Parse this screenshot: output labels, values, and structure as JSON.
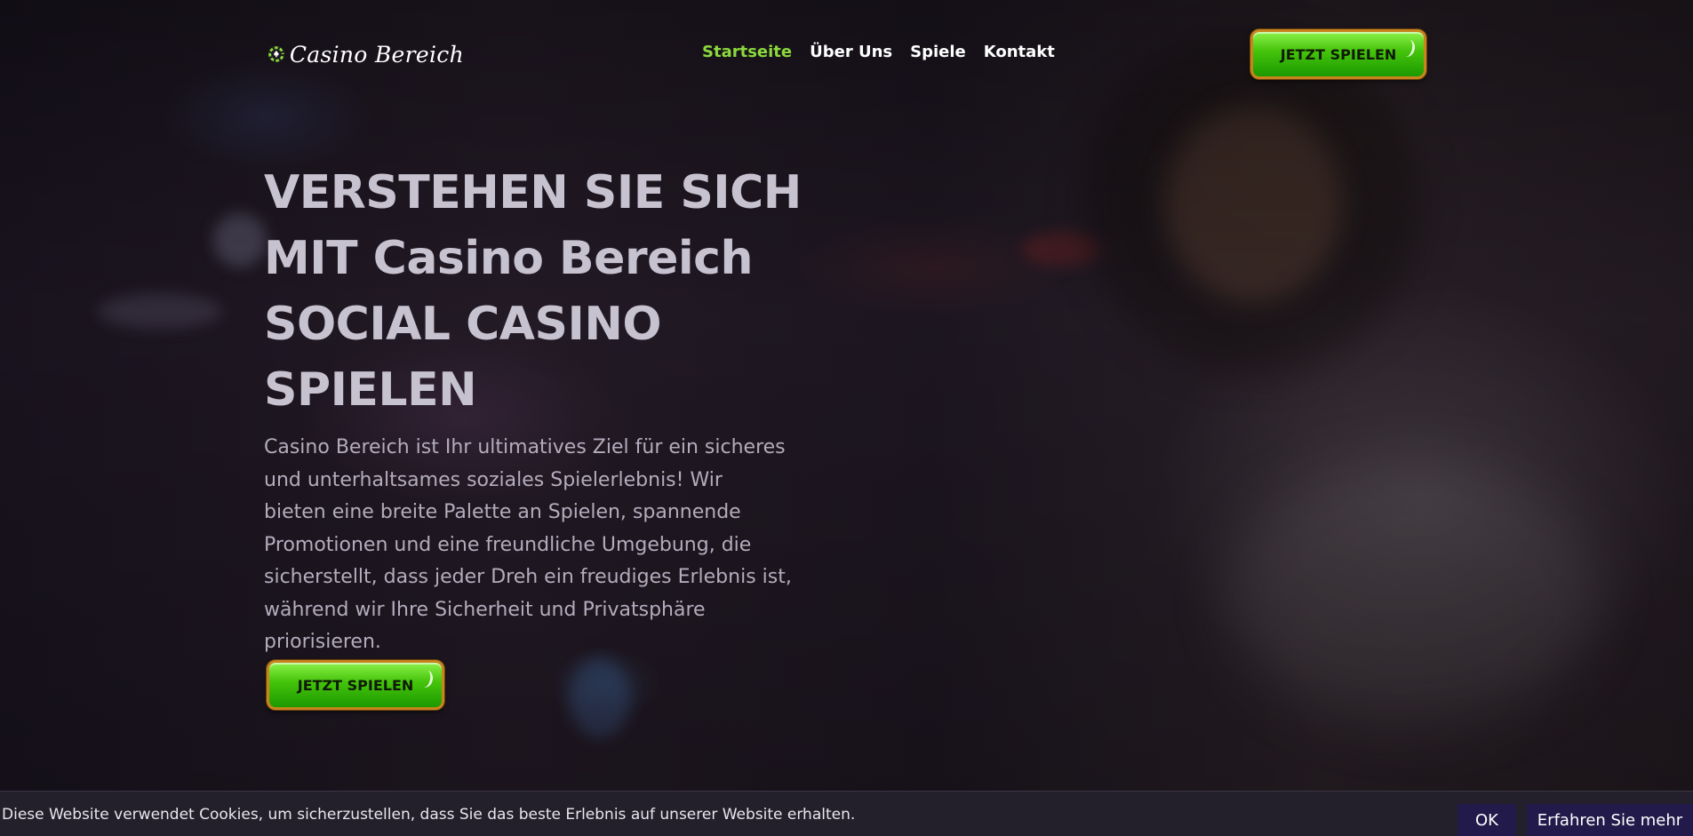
{
  "header": {
    "logo_text": "Casino Bereich",
    "nav": [
      {
        "label": "Startseite",
        "active": true
      },
      {
        "label": "Über Uns",
        "active": false
      },
      {
        "label": "Spiele",
        "active": false
      },
      {
        "label": "Kontakt",
        "active": false
      }
    ],
    "cta_label": "JETZT SPIELEN"
  },
  "hero": {
    "headline_lines": [
      "VERSTEHEN SIE SICH",
      "MIT Casino Bereich",
      "SOCIAL CASINO",
      "SPIELEN"
    ],
    "body_lines": [
      "Casino Bereich ist Ihr ultimatives Ziel für ein sicheres",
      "und unterhaltsames soziales Spielerlebnis! Wir",
      "bieten eine breite Palette an Spielen, spannende",
      "Promotionen und eine freundliche Umgebung, die",
      "sicherstellt, dass jeder Dreh ein freudiges Erlebnis ist,",
      "während wir Ihre Sicherheit und Privatsphäre",
      "priorisieren."
    ],
    "cta_label": "JETZT SPIELEN"
  },
  "cookie": {
    "text": "Diese Website verwendet Cookies, um sicherzustellen, dass Sie das beste Erlebnis auf unserer Website erhalten.",
    "ok_label": "OK",
    "more_label": "Erfahren Sie mehr"
  },
  "colors": {
    "accent_green": "#8bd93d",
    "button_green": "#46c50c",
    "button_border": "#c8851e",
    "cookie_bg": "#23202b",
    "cookie_button_bg": "#221a4a"
  },
  "icons": {
    "logo": "casino-chip-spade-icon"
  }
}
